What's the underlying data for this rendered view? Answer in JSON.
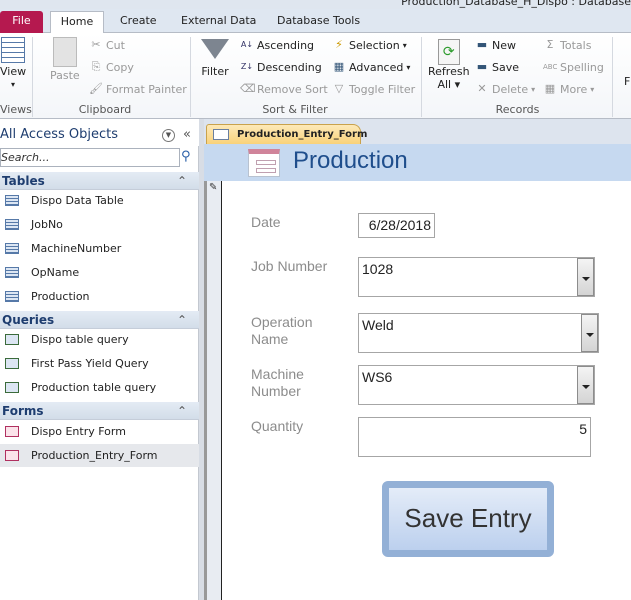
{
  "window": {
    "title": "Production_Database_H_Dispo : Database"
  },
  "ribbon": {
    "tabs": [
      "File",
      "Home",
      "Create",
      "External Data",
      "Database Tools"
    ],
    "views": {
      "view": "View",
      "group": "Views"
    },
    "clipboard": {
      "paste": "Paste",
      "cut": "Cut",
      "copy": "Copy",
      "format_painter": "Format Painter",
      "group": "Clipboard"
    },
    "sort_filter": {
      "filter": "Filter",
      "ascending": "Ascending",
      "descending": "Descending",
      "remove_sort": "Remove Sort",
      "selection": "Selection",
      "advanced": "Advanced",
      "toggle_filter": "Toggle Filter",
      "group": "Sort & Filter"
    },
    "records": {
      "refresh": "Refresh",
      "refresh_all": "All",
      "new": "New",
      "save": "Save",
      "delete": "Delete",
      "totals": "Totals",
      "spelling": "Spelling",
      "more": "More",
      "group": "Records"
    },
    "find_partial": "F"
  },
  "nav": {
    "title": "All Access Objects",
    "search_placeholder": "Search...",
    "sections": [
      {
        "label": "Tables",
        "items": [
          "Dispo Data Table",
          "JobNo",
          "MachineNumber",
          "OpName",
          "Production"
        ]
      },
      {
        "label": "Queries",
        "items": [
          "Dispo table query",
          "First Pass Yield Query",
          "Production table query"
        ]
      },
      {
        "label": "Forms",
        "items": [
          "Dispo Entry Form",
          "Production_Entry_Form"
        ]
      }
    ]
  },
  "document": {
    "tab": "Production_Entry_Form",
    "form_title": "Production",
    "fields": {
      "date": {
        "label": "Date",
        "value": "6/28/2018"
      },
      "job_number": {
        "label": "Job Number",
        "value": "1028"
      },
      "operation_name": {
        "label": "Operation Name",
        "value": "Weld"
      },
      "machine_number": {
        "label": "Machine Number",
        "value": "WS6"
      },
      "quantity": {
        "label": "Quantity",
        "value": "5"
      }
    },
    "save_button": "Save Entry"
  }
}
